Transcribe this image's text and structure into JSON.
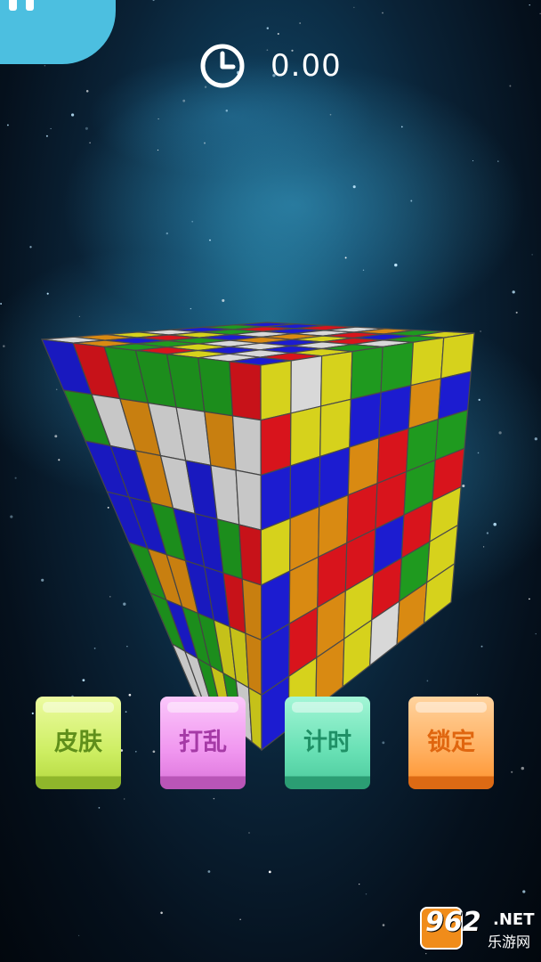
{
  "hud": {
    "timer_value": "0.00",
    "pause_icon": "pause-icon",
    "clock_icon": "clock-icon",
    "accent_color": "#4cbfe0"
  },
  "cube": {
    "size": "7x7",
    "colors": {
      "R": "#d8141c",
      "G": "#1f9a1f",
      "B": "#1c1cd0",
      "Y": "#d6d21c",
      "O": "#d98a12",
      "W": "#d8d8d8"
    },
    "front_face": [
      "BRGGGGR",
      "GWOWWOW",
      "BBOWBWW",
      "BBGBBGR",
      "GOOBBRO",
      "GBGGYYO",
      "WWGYGWY"
    ],
    "right_face": [
      "YWYGGYY",
      "RYYBBOB",
      "BBBORGG",
      "YOORRGR",
      "BORRBRY",
      "BROYRGY",
      "BYOYWOY"
    ],
    "top_face": [
      "BBRWOGY",
      "GRBWRBG",
      "BGWOYRW",
      "WYBOBWG",
      "YRGWWBY",
      "OBGYBWR",
      "WOGRYWB"
    ]
  },
  "buttons": [
    {
      "label": "皮肤",
      "color": "#cdee62"
    },
    {
      "label": "打乱",
      "color": "#f095ef"
    },
    {
      "label": "计时",
      "color": "#67e0b4"
    },
    {
      "label": "锁定",
      "color": "#ffae5d"
    }
  ],
  "watermark": {
    "brand": "962",
    "suffix": ".NET",
    "sub": "乐游网"
  }
}
